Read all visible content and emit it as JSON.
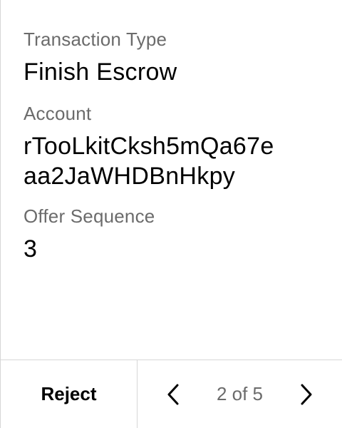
{
  "fields": [
    {
      "label": "Transaction Type",
      "value_lines": [
        "Finish Escrow"
      ]
    },
    {
      "label": "Account",
      "value_lines": [
        "rTooLkitCksh5mQa67e",
        "aa2JaWHDBnHkpy"
      ]
    },
    {
      "label": "Offer Sequence",
      "value_lines": [
        "3"
      ]
    }
  ],
  "footer": {
    "reject_label": "Reject",
    "pager_text": "2 of 5",
    "prev_icon": "chevron-left-icon",
    "next_icon": "chevron-right-icon"
  },
  "colors": {
    "label": "#6b6b6b",
    "value": "#000000",
    "border": "#d6d6d6"
  }
}
